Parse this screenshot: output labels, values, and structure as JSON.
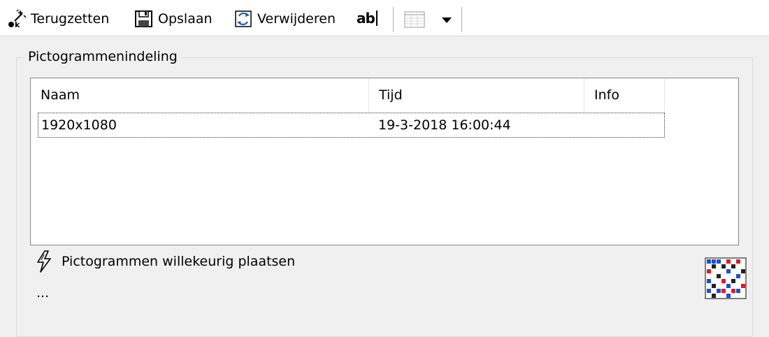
{
  "toolbar": {
    "restore_label": "Terugzetten",
    "save_label": "Opslaan",
    "delete_label": "Verwijderen",
    "rename_label": "ab"
  },
  "group": {
    "legend": "Pictogrammenindeling"
  },
  "list": {
    "columns": [
      "Naam",
      "Tijd",
      "Info"
    ],
    "rows": [
      {
        "name": "1920x1080",
        "time": "19-3-2018 16:00:44",
        "info": ""
      }
    ]
  },
  "options": {
    "random_label": "Pictogrammen willekeurig plaatsen",
    "more_label": "..."
  },
  "icons": {
    "restore": "magic-wand-icon",
    "save": "floppy-disk-icon",
    "delete": "recycle-icon",
    "rename": "rename-text-icon",
    "view": "grid-view-icon",
    "random": "lightning-icon",
    "app": "desktop-icon-grid-icon"
  },
  "colors": {
    "toolbar_bg": "#ffffff",
    "window_bg": "#f0f0f0",
    "list_border": "#828790"
  }
}
